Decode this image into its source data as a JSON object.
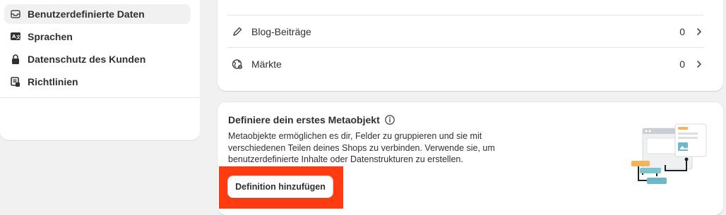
{
  "sidebar": {
    "items": [
      {
        "label": "Benutzerdefinierte Daten",
        "icon": "database-icon",
        "active": true
      },
      {
        "label": "Sprachen",
        "icon": "translate-icon",
        "active": false
      },
      {
        "label": "Datenschutz des Kunden",
        "icon": "lock-icon",
        "active": false
      },
      {
        "label": "Richtlinien",
        "icon": "policy-icon",
        "active": false
      }
    ]
  },
  "list": {
    "rows": [
      {
        "label": "Blog-Beiträge",
        "count": "0",
        "icon": "pencil-icon"
      },
      {
        "label": "Märkte",
        "count": "0",
        "icon": "globe-icon"
      }
    ]
  },
  "metaobject": {
    "title": "Definiere dein erstes Metaobjekt",
    "description": "Metaobjekte ermöglichen es dir, Felder zu gruppieren und sie mit verschiedenen Teilen deines Shops zu verbinden. Verwende sie, um benutzerdefinierte Inhalte oder Datenstrukturen zu erstellen.",
    "button_label": "Definition hinzufügen"
  },
  "colors": {
    "highlight": "#ff3b0f",
    "background": "#f1f1f1",
    "card": "#ffffff"
  }
}
